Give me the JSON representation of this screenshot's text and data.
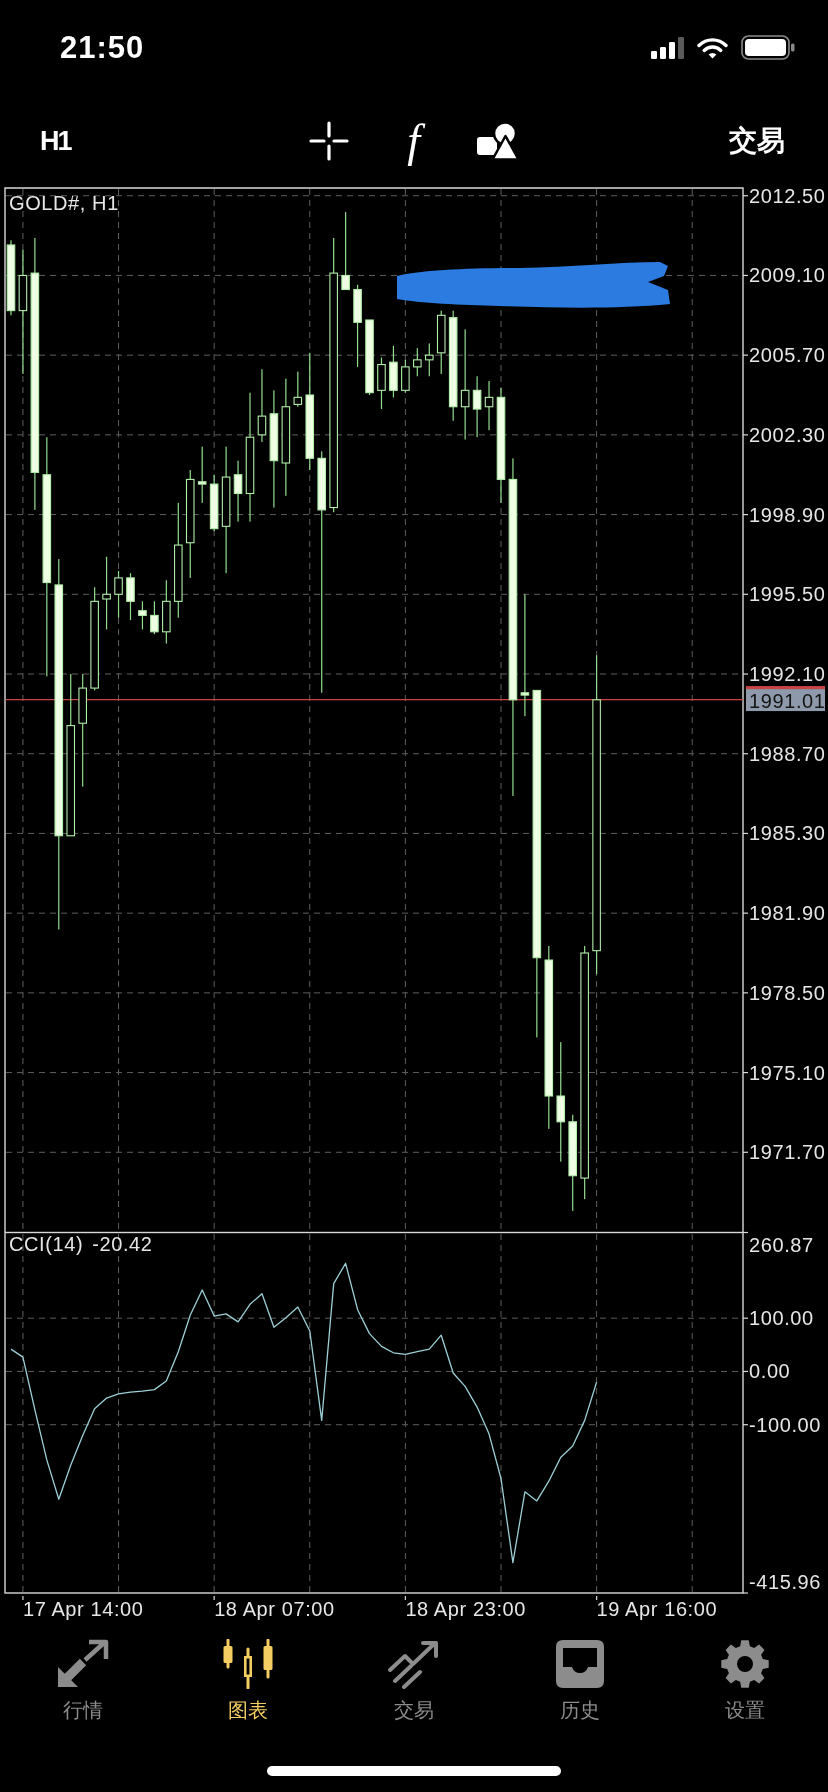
{
  "status_bar": {
    "time": "21:50"
  },
  "toolbar": {
    "timeframe": "H1",
    "indicator_button": "f",
    "trade_button": "交易"
  },
  "chart": {
    "chart_data": {
      "type": "candlestick",
      "title": "GOLD#, H1",
      "grid": true,
      "categories": [
        null,
        null,
        null,
        null,
        null,
        null,
        null,
        null,
        null,
        null,
        null,
        null,
        null,
        null,
        null,
        null,
        null,
        null,
        null,
        null,
        null,
        null,
        null,
        null,
        null,
        null,
        null,
        null,
        null,
        null,
        null,
        null,
        null,
        null,
        null,
        null,
        null,
        null,
        null,
        null,
        null,
        null,
        null,
        null,
        null,
        null,
        null,
        null,
        null,
        null,
        null,
        null,
        null,
        null,
        null,
        null,
        null,
        null,
        null,
        null,
        null,
        null
      ],
      "ylim": [
        1968.3,
        2012.83
      ],
      "yticks": [
        {
          "value": 2012.5,
          "label": "2012.50"
        },
        {
          "value": 2009.1,
          "label": "2009.10"
        },
        {
          "value": 2005.7,
          "label": "2005.70"
        },
        {
          "value": 2002.3,
          "label": "2002.30"
        },
        {
          "value": 1998.9,
          "label": "1998.90"
        },
        {
          "value": 1995.5,
          "label": "1995.50"
        },
        {
          "value": 1992.1,
          "label": "1992.10"
        },
        {
          "value": 1988.7,
          "label": "1988.70"
        },
        {
          "value": 1985.3,
          "label": "1985.30"
        },
        {
          "value": 1981.9,
          "label": "1981.90"
        },
        {
          "value": 1978.5,
          "label": "1978.50"
        },
        {
          "value": 1975.1,
          "label": "1975.10"
        },
        {
          "value": 1971.7,
          "label": "1971.70"
        }
      ],
      "ref_lines": [
        {
          "axis": "y",
          "value": 1991.01,
          "label": "1991.01",
          "color": "#c94545"
        }
      ],
      "ohlc": [
        [
          2010.4,
          2010.6,
          2007.4,
          2007.6
        ],
        [
          2007.6,
          2010.2,
          2004.9,
          2009.1
        ],
        [
          2009.2,
          2010.7,
          1999.1,
          2000.7
        ],
        [
          2000.6,
          2002.2,
          1992.0,
          1996.0
        ],
        [
          1995.9,
          1997.0,
          1981.2,
          1985.2
        ],
        [
          1985.2,
          1992.1,
          1985.2,
          1989.9
        ],
        [
          1990.0,
          1992.1,
          1987.3,
          1991.5
        ],
        [
          1991.5,
          1995.8,
          1991.4,
          1995.2
        ],
        [
          1995.3,
          1997.1,
          1994.0,
          1995.5
        ],
        [
          1995.5,
          1996.5,
          1994.5,
          1996.2
        ],
        [
          1996.2,
          1996.4,
          1994.4,
          1995.2
        ],
        [
          1994.8,
          1995.2,
          1994.0,
          1994.6
        ],
        [
          1994.6,
          1995.2,
          1993.8,
          1993.9
        ],
        [
          1993.9,
          1996.1,
          1993.4,
          1995.2
        ],
        [
          1995.2,
          1999.4,
          1994.5,
          1997.6
        ],
        [
          1997.7,
          2000.8,
          1996.2,
          2000.4
        ],
        [
          2000.3,
          2001.8,
          1999.4,
          2000.2
        ],
        [
          2000.2,
          2000.6,
          1998.2,
          1998.3
        ],
        [
          1998.4,
          2001.8,
          1996.4,
          2000.5
        ],
        [
          2000.6,
          2001.2,
          1998.6,
          1999.8
        ],
        [
          1999.8,
          2004.1,
          1998.6,
          2002.2
        ],
        [
          2002.3,
          2005.1,
          2002.0,
          2003.1
        ],
        [
          2003.2,
          2004.2,
          1999.2,
          2001.2
        ],
        [
          2001.1,
          2004.7,
          1999.7,
          2003.5
        ],
        [
          2003.6,
          2005.0,
          2003.5,
          2003.9
        ],
        [
          2004.0,
          2005.8,
          2000.8,
          2001.3
        ],
        [
          2001.3,
          2001.6,
          1991.3,
          1999.1
        ],
        [
          1999.2,
          2010.7,
          1999.0,
          2009.2
        ],
        [
          2009.1,
          2011.8,
          2008.5,
          2008.5
        ],
        [
          2008.5,
          2008.7,
          2005.2,
          2007.1
        ],
        [
          2007.2,
          2007.2,
          2004.0,
          2004.1
        ],
        [
          2004.2,
          2005.6,
          2003.4,
          2005.3
        ],
        [
          2005.4,
          2006.1,
          2003.9,
          2004.2
        ],
        [
          2004.2,
          2005.5,
          2004.1,
          2005.2
        ],
        [
          2005.2,
          2006.0,
          2004.8,
          2005.5
        ],
        [
          2005.5,
          2006.2,
          2004.8,
          2005.7
        ],
        [
          2005.8,
          2007.6,
          2004.9,
          2007.4
        ],
        [
          2007.3,
          2007.6,
          2002.9,
          2003.5
        ],
        [
          2003.5,
          2006.8,
          2002.1,
          2004.2
        ],
        [
          2004.2,
          2004.8,
          2002.2,
          2003.4
        ],
        [
          2003.5,
          2004.6,
          2002.5,
          2003.9
        ],
        [
          2003.9,
          2004.3,
          1999.4,
          2000.4
        ],
        [
          2000.4,
          2001.3,
          1986.9,
          1991.0
        ],
        [
          1991.3,
          1995.5,
          1990.3,
          1991.2
        ],
        [
          1991.4,
          1991.4,
          1976.6,
          1980.0
        ],
        [
          1979.9,
          1980.5,
          1972.7,
          1974.1
        ],
        [
          1974.1,
          1976.4,
          1971.3,
          1973.0
        ],
        [
          1973.0,
          1973.3,
          1969.2,
          1970.7
        ],
        [
          1970.6,
          1980.5,
          1969.7,
          1980.2
        ],
        [
          1980.3,
          1992.9,
          1979.3,
          1991.0
        ],
        null,
        null,
        null,
        null,
        null,
        null,
        null,
        null,
        null,
        null,
        null,
        null
      ]
    },
    "indicator": {
      "value": "-20.42",
      "chart_data": {
        "type": "line",
        "grid": true,
        "categories": [
          null,
          null,
          null,
          null,
          null,
          null,
          null,
          null,
          null,
          null,
          null,
          null,
          null,
          null,
          null,
          null,
          null,
          null,
          null,
          null,
          null,
          null,
          null,
          null,
          null,
          null,
          null,
          null,
          null,
          null,
          null,
          null,
          null,
          null,
          null,
          null,
          null,
          null,
          null,
          null,
          null,
          null,
          null,
          null,
          null,
          null,
          null,
          null,
          null,
          null,
          null,
          null,
          null,
          null,
          null,
          null,
          null,
          null,
          null,
          null,
          null,
          null
        ],
        "ylim": [
          -415.96,
          260.87
        ],
        "yticks": [
          {
            "value": 260.87,
            "label": "260.87"
          },
          {
            "value": 100,
            "label": "100.00"
          },
          {
            "value": 0,
            "label": "0.00"
          },
          {
            "value": -100,
            "label": "-100.00"
          },
          {
            "value": -415.96,
            "label": "-415.96"
          }
        ],
        "series": [
          {
            "name": "CCI(14)",
            "color": "#9ccfd6",
            "values": [
              42,
              27,
              -72,
              -166,
              -240,
              -176,
              -120,
              -70,
              -50,
              -42,
              -39,
              -37,
              -34,
              -18,
              37,
              106,
              153,
              104,
              108,
              93,
              126,
              146,
              83,
              101,
              121,
              76,
              -92,
              165,
              203,
              116,
              71,
              47,
              35,
              32,
              37,
              42,
              68,
              -3,
              -28,
              -67,
              -117,
              -201,
              -359,
              -226,
              -243,
              -206,
              -161,
              -140,
              -92,
              -20.42,
              null,
              null,
              null,
              null,
              null,
              null,
              null,
              null,
              null,
              null,
              null,
              null
            ]
          }
        ]
      }
    },
    "time_axis": [
      "17 Apr 14:00",
      "18 Apr 07:00",
      "18 Apr 23:00",
      "19 Apr 16:00"
    ]
  },
  "tab_bar": {
    "items": [
      {
        "kind": "quotes",
        "label": "行情",
        "selected": false
      },
      {
        "kind": "chart",
        "label": "图表",
        "selected": true
      },
      {
        "kind": "trade",
        "label": "交易",
        "selected": false
      },
      {
        "kind": "history",
        "label": "历史",
        "selected": false
      },
      {
        "kind": "settings",
        "label": "设置",
        "selected": false
      }
    ]
  }
}
